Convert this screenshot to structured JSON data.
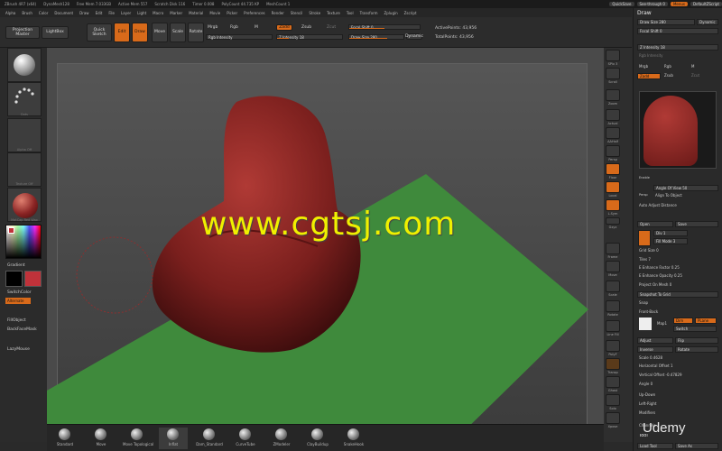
{
  "titlebar": {
    "items": [
      "ZBrush 4R7 (x64)",
      "DynaMesh128",
      "Free Mem 7.033GB",
      "Active Mem 557",
      "Scratch Disk 116",
      "Timer 0.008",
      "PolyCount 44.735 KP",
      "MeshCount 1"
    ],
    "quicksave": "QuickSave",
    "seethrough": "See-through 0",
    "menus": "Menus",
    "script": "DefaultZScript"
  },
  "menubar": [
    "Alpha",
    "Brush",
    "Color",
    "Document",
    "Draw",
    "Edit",
    "File",
    "Layer",
    "Light",
    "Macro",
    "Marker",
    "Material",
    "Movie",
    "Picker",
    "Preferences",
    "Render",
    "Stencil",
    "Stroke",
    "Texture",
    "Tool",
    "Transform",
    "Zplugin",
    "Zscript"
  ],
  "toolbar": {
    "projection_master": "Projection Master",
    "lightbox": "LightBox",
    "quick_sketch": "Quick Sketch",
    "edit": "Edit",
    "draw": "Draw",
    "move": "Move",
    "scale": "Scale",
    "rotate": "Rotate",
    "mrgb": "Mrgb",
    "rgb": "Rgb",
    "m": "M",
    "rgb_intensity": "Rgb Intensity",
    "zadd": "Zadd",
    "zsub": "Zsub",
    "zcut": "Zcut",
    "z_intensity": "Z Intensity 18",
    "focal_shift": "Focal Shift 0",
    "draw_size": "Draw Size 280",
    "dynamic": "Dynamic",
    "active_points": "ActivePoints: 43,956",
    "total_points": "TotalPoints: 43,956"
  },
  "left_shelf": {
    "thumb_captions": [
      "",
      "Dots",
      "",
      "Alpha Off",
      "Texture Off",
      "MatCap Red Wax"
    ],
    "gradient": "Gradient",
    "switch_color": "SwitchColor",
    "alternate": "Alternate",
    "fill_object": "FillObject",
    "backface_mask": "BackFaceMask",
    "lazy_mouse": "LazyMouse"
  },
  "right_shelf": [
    "SPix 3",
    "Scroll",
    "Zoom",
    "Actual",
    "AAHalf",
    "Persp",
    "Floor",
    "Local",
    "L.Sym",
    "Gxyz",
    "Frame",
    "Move",
    "Scale",
    "Rotate",
    "Line Fill",
    "PolyF",
    "Transp",
    "Ghost",
    "Solo",
    "Xpose"
  ],
  "tray": {
    "header": "Draw",
    "draw_size": "Draw Size 280",
    "dynamic": "Dynamic",
    "focal_shift": "Focal Shift 0",
    "z_intensity": "Z Intensity 18",
    "rgb_intensity": "Rgb Intensity",
    "mrgb": "Mrgb",
    "rgb": "Rgb",
    "m": "M",
    "zadd": "Zadd",
    "zsub": "Zsub",
    "zcut": "Zcut",
    "enable": "Enable",
    "angle_of_view": "Angle Of View 50",
    "align_to_object": "Align To Object",
    "auto_adjust_distance": "Auto Adjust Distance",
    "persp": "Persp",
    "open": "Open",
    "save": "Save",
    "div": "Div 1",
    "fill_mode": "Fill Mode 3",
    "grid_size": "Grid Size 0",
    "tiles": "Tiles 7",
    "e_enhance_factor": "E Enhance Factor 0.25",
    "e_enhance_opacity": "E Enhance Opacity 0.25",
    "project_on_mesh": "Project On Mesh 0",
    "snapshot_to_grid": "Snapshot To Grid",
    "snap": "Snap",
    "front_back": "Front-Back",
    "map": "Map1",
    "dim": "Dim",
    "plane": "PLane",
    "switch": "Switch",
    "adjust": "Adjust",
    "flip": "Flip",
    "inverse": "Inverse",
    "rotate": "Rotate",
    "scale": "Scale 0.4628",
    "horizontal_offset": "Horizontal Offset 1",
    "vertical_offset": "Vertical Offset -0.47829",
    "angle": "Angle 0",
    "up_down": "Up-Down",
    "left_right": "Left-Right",
    "modifiers": "Modifiers",
    "channels": "Channels",
    "tool": "Tool",
    "load_tool": "Load Tool",
    "save_as": "Save As"
  },
  "brushes": [
    "Standard",
    "Move",
    "Move Topological",
    "Inflat",
    "Dam_Standard",
    "CurveTube",
    "ZModeler",
    "ClayBuildup",
    "SnakeHook"
  ],
  "watermark": "www.cgtsj.com",
  "udemy": "Udemy",
  "colors": {
    "accent": "#d86a1a",
    "model": "#8a2424",
    "floor": "#3f8a3c",
    "watermark": "#f0f000"
  }
}
